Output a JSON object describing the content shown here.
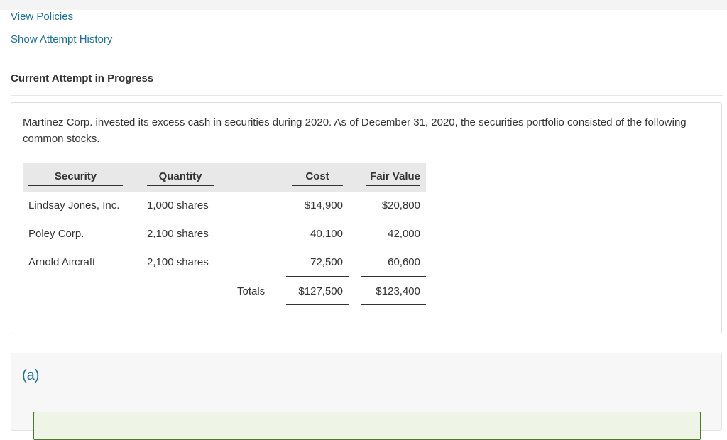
{
  "links": {
    "view_policies": "View Policies",
    "show_attempt_history": "Show Attempt History"
  },
  "attempt_heading": "Current Attempt in Progress",
  "question": {
    "text": "Martinez Corp. invested its excess cash in securities during 2020. As of December 31, 2020, the securities portfolio consisted of the following common stocks."
  },
  "table": {
    "headers": {
      "security": "Security",
      "quantity": "Quantity",
      "cost": "Cost",
      "fair_value": "Fair Value"
    },
    "rows": [
      {
        "security": "Lindsay Jones, Inc.",
        "quantity": "1,000 shares",
        "cost": "$14,900",
        "fair_value": "$20,800"
      },
      {
        "security": "Poley Corp.",
        "quantity": "2,100 shares",
        "cost": "40,100",
        "fair_value": "42,000"
      },
      {
        "security": "Arnold Aircraft",
        "quantity": "2,100 shares",
        "cost": "72,500",
        "fair_value": "60,600"
      }
    ],
    "totals": {
      "label": "Totals",
      "cost": "$127,500",
      "fair_value": "$123,400"
    }
  },
  "part": {
    "label": "(a)"
  },
  "colors": {
    "link": "#1a6f9e",
    "header_band": "#e8e8e8",
    "answer_box_border": "#4c7a2a",
    "answer_box_fill": "#eef5e6"
  }
}
